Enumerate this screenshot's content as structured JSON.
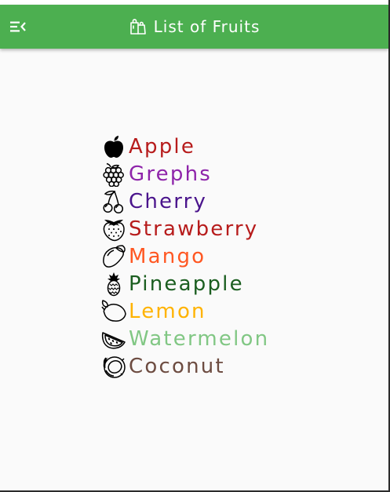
{
  "app_bar": {
    "title": "List of Fruits",
    "background": "#4caf50",
    "menu_icon": "menu-open-icon",
    "title_icon": "shopping-bags-icon"
  },
  "fruits": [
    {
      "name": "Apple",
      "color": "#b71c1c",
      "icon": "apple-icon"
    },
    {
      "name": "Grephs",
      "color": "#8e24aa",
      "icon": "grapes-icon"
    },
    {
      "name": "Cherry",
      "color": "#4a148c",
      "icon": "cherry-icon"
    },
    {
      "name": "Strawberry",
      "color": "#b71c1c",
      "icon": "strawberry-icon"
    },
    {
      "name": "Mango",
      "color": "#ff5722",
      "icon": "mango-icon"
    },
    {
      "name": "Pineapple",
      "color": "#1b5e20",
      "icon": "pineapple-icon"
    },
    {
      "name": "Lemon",
      "color": "#ffb300",
      "icon": "lemon-icon"
    },
    {
      "name": "Watermelon",
      "color": "#81c784",
      "icon": "watermelon-icon"
    },
    {
      "name": "Coconut",
      "color": "#6d4c41",
      "icon": "coconut-icon"
    }
  ]
}
